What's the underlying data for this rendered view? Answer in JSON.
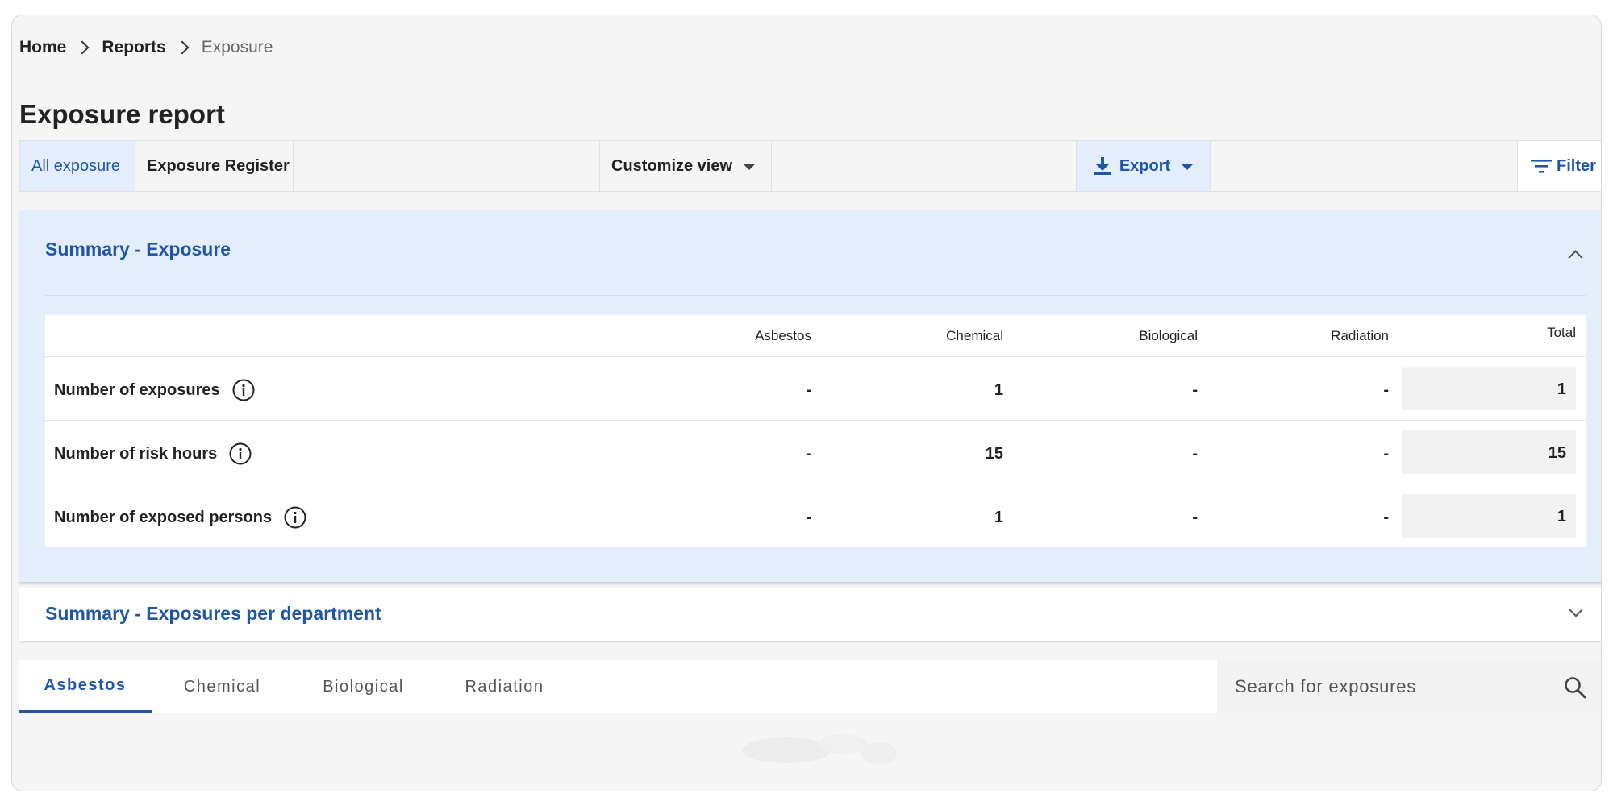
{
  "breadcrumb": {
    "items": [
      "Home",
      "Reports"
    ],
    "current": "Exposure"
  },
  "page": {
    "title": "Exposure report"
  },
  "toolbar": {
    "tab_all": "All exposure",
    "tab_register": "Exposure Register",
    "customize": "Customize view",
    "export": "Export",
    "filter": "Filter"
  },
  "summary_exposure": {
    "title": "Summary - Exposure",
    "columns": [
      "Asbestos",
      "Chemical",
      "Biological",
      "Radiation",
      "Total"
    ],
    "rows": [
      {
        "label": "Number of exposures",
        "values": [
          "-",
          "1",
          "-",
          "-"
        ],
        "total": "1"
      },
      {
        "label": "Number of risk hours",
        "values": [
          "-",
          "15",
          "-",
          "-"
        ],
        "total": "15"
      },
      {
        "label": "Number of exposed persons",
        "values": [
          "-",
          "1",
          "-",
          "-"
        ],
        "total": "1"
      }
    ]
  },
  "summary_department": {
    "title": "Summary - Exposures per department"
  },
  "category_tabs": [
    "Asbestos",
    "Chemical",
    "Biological",
    "Radiation"
  ],
  "search": {
    "placeholder": "Search for exposures",
    "value": ""
  },
  "colors": {
    "accent": "#1f56a6",
    "panel_bg": "#e3edfb",
    "page_bg": "#f5f5f5"
  },
  "icons": [
    "chevron-right-icon",
    "download-icon",
    "caret-down-icon",
    "filter-icon",
    "chevron-up-icon",
    "chevron-down-icon",
    "info-icon",
    "search-icon"
  ]
}
